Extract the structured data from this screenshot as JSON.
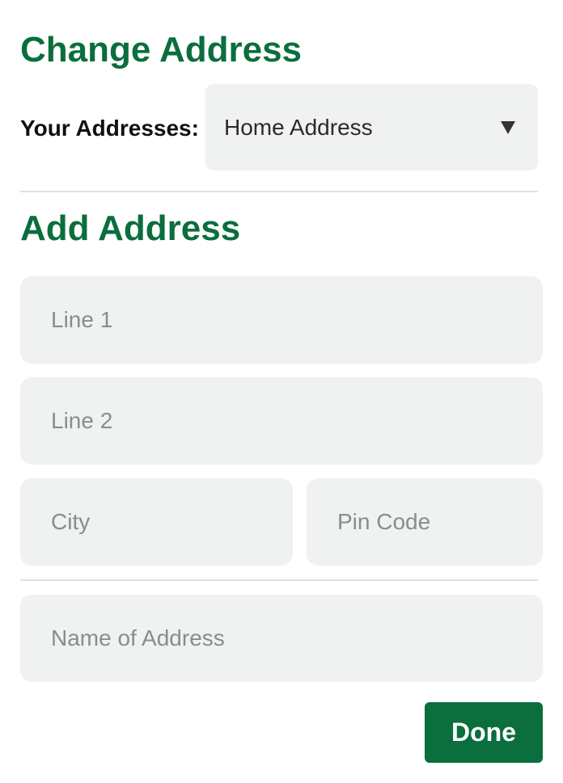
{
  "change_section": {
    "title": "Change Address",
    "select_label": "Your Addresses:",
    "selected_address": "Home Address"
  },
  "add_section": {
    "title": "Add Address",
    "fields": {
      "line1_placeholder": "Line 1",
      "line2_placeholder": "Line 2",
      "city_placeholder": "City",
      "pin_placeholder": "Pin Code",
      "name_placeholder": "Name of Address"
    },
    "done_label": "Done"
  },
  "icons": {
    "dropdown": "chevron-down-icon"
  },
  "colors": {
    "accent": "#0a6e3d",
    "field_background": "#f0f1f1",
    "placeholder": "#8a8d8d"
  }
}
